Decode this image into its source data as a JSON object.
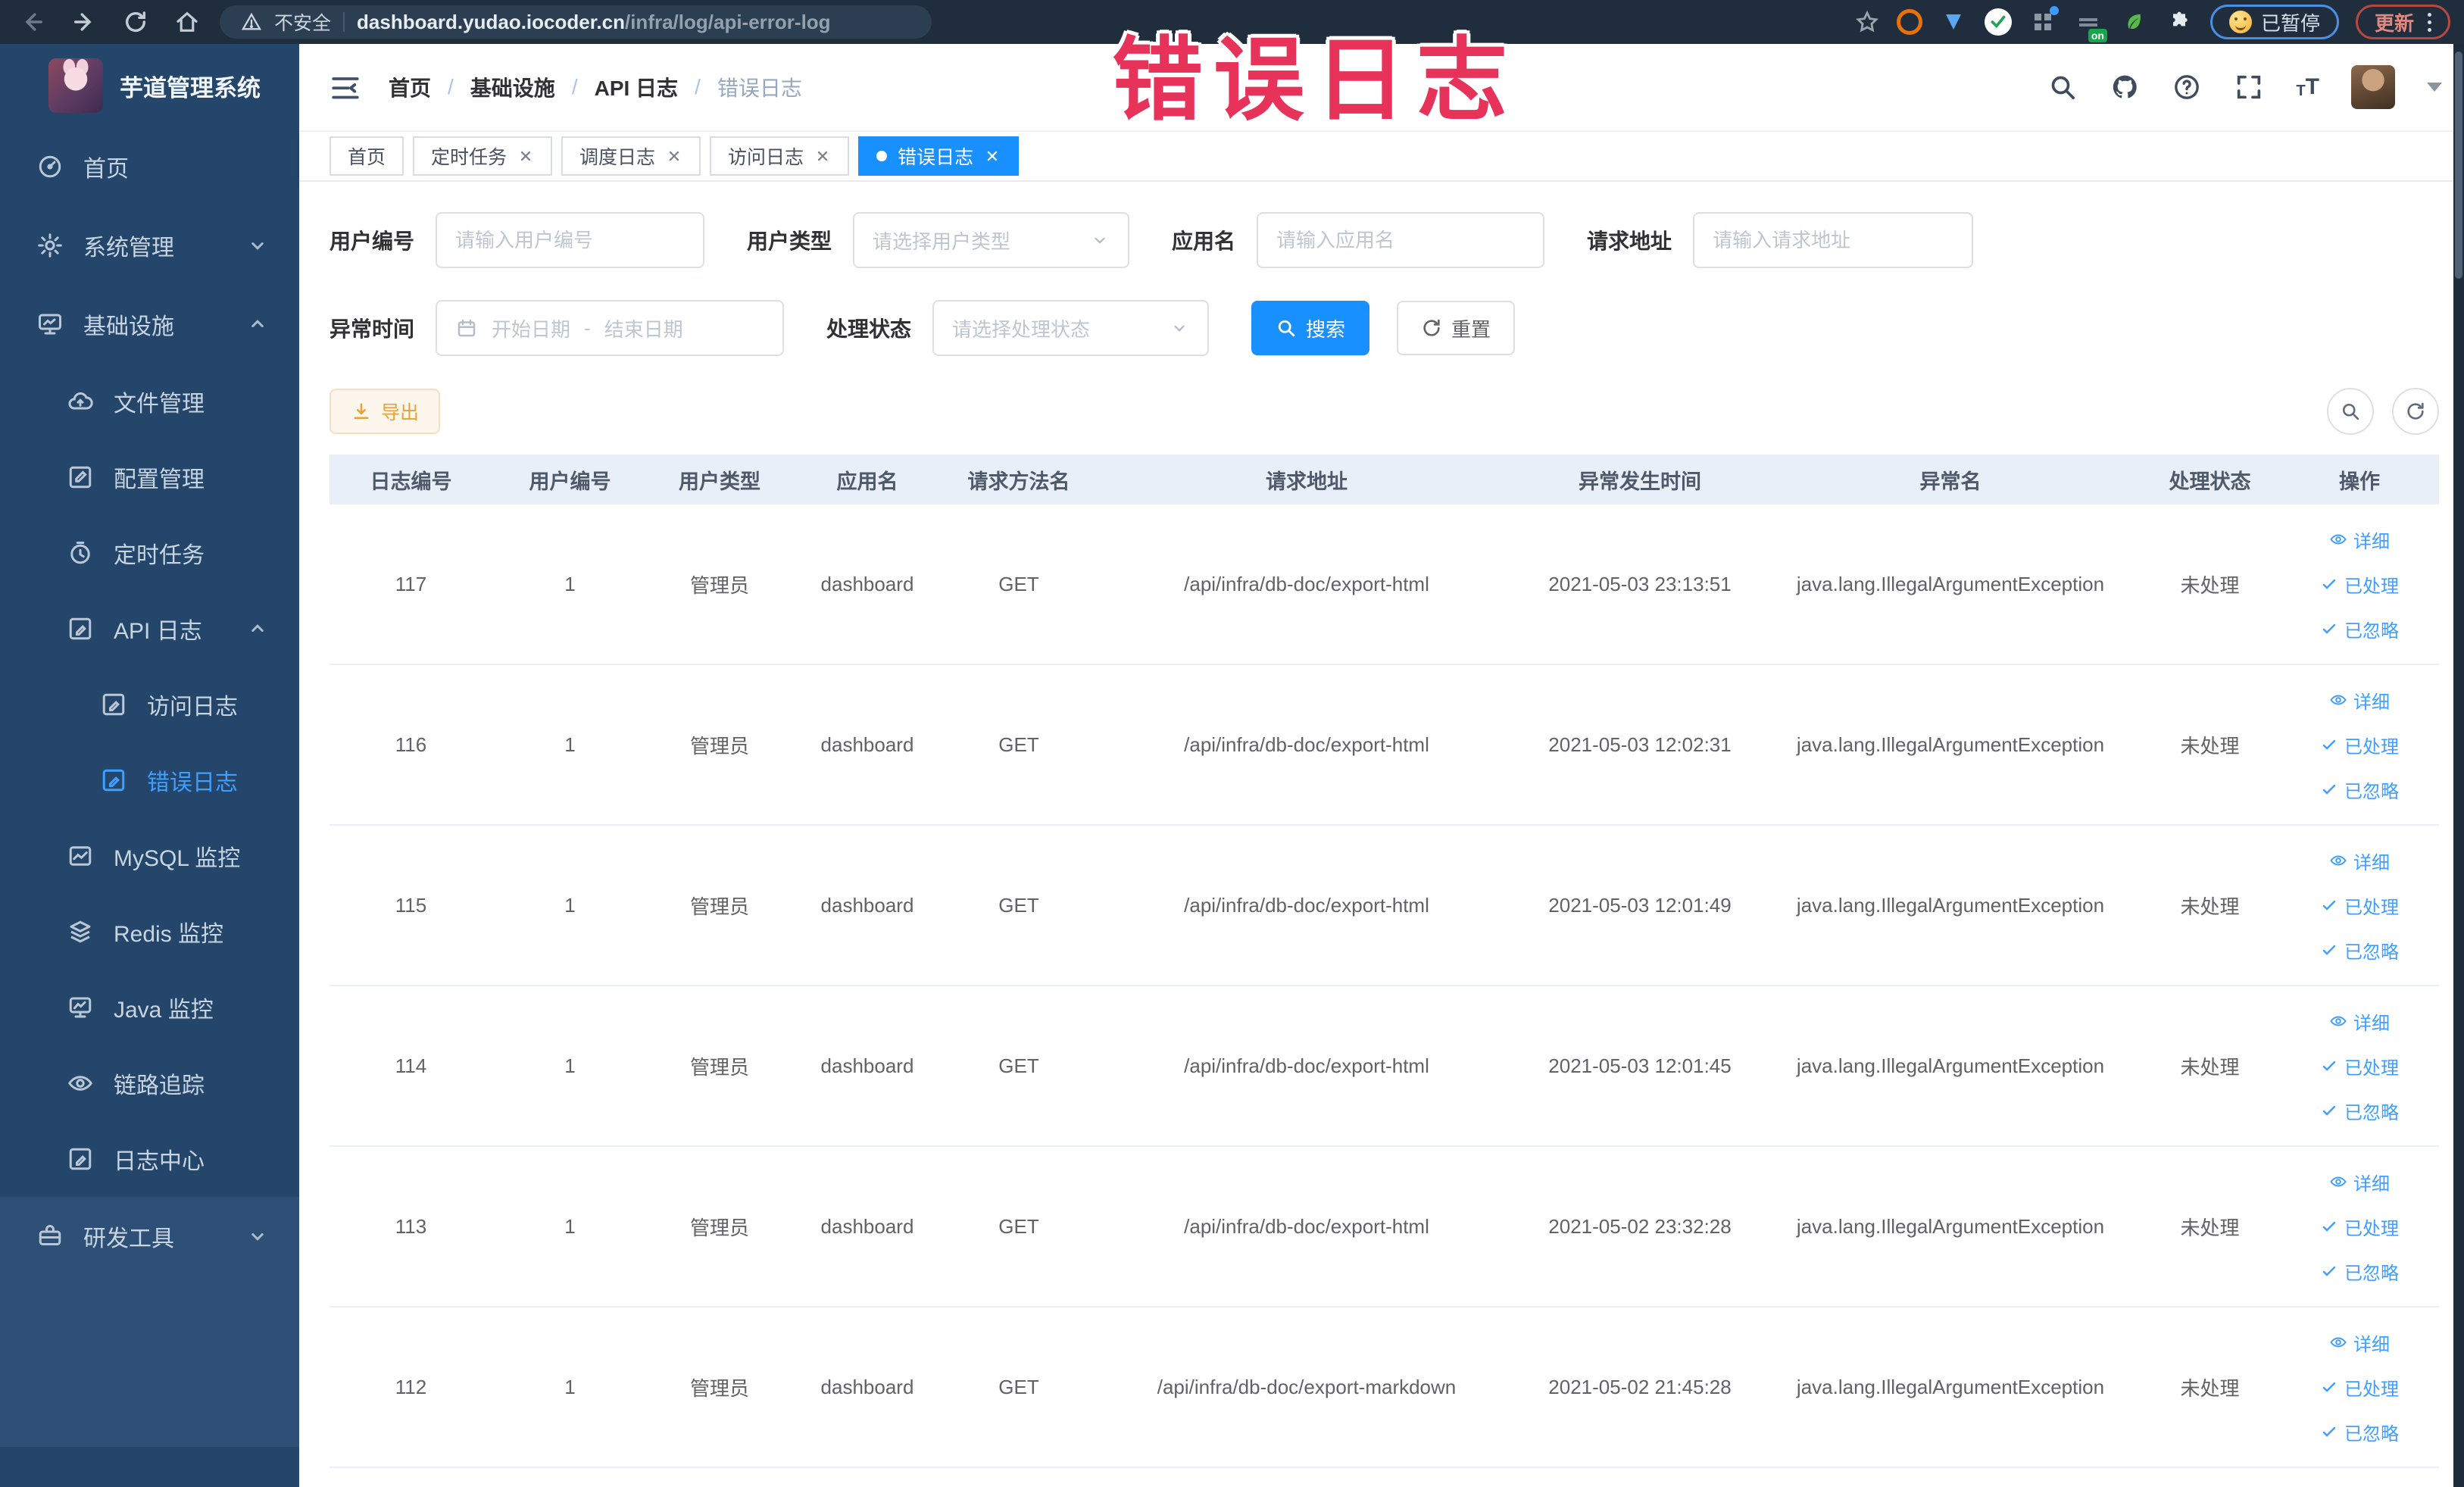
{
  "annotation": {
    "text": "错误日志",
    "color": "#e7325a"
  },
  "browser": {
    "security_label": "不安全",
    "url_host": "dashboard.yudao.iocoder.cn",
    "url_path": "/infra/log/api-error-log",
    "extension_badge": "on",
    "paused_label": "已暂停",
    "update_label": "更新"
  },
  "sidebar": {
    "app_title": "芋道管理系统",
    "items": [
      {
        "label": "首页"
      },
      {
        "label": "系统管理"
      },
      {
        "label": "基础设施"
      },
      {
        "label": "文件管理"
      },
      {
        "label": "配置管理"
      },
      {
        "label": "定时任务"
      },
      {
        "label": "API 日志"
      },
      {
        "label": "访问日志"
      },
      {
        "label": "错误日志"
      },
      {
        "label": "MySQL 监控"
      },
      {
        "label": "Redis 监控"
      },
      {
        "label": "Java 监控"
      },
      {
        "label": "链路追踪"
      },
      {
        "label": "日志中心"
      },
      {
        "label": "研发工具"
      }
    ]
  },
  "header": {
    "breadcrumb": [
      "首页",
      "基础设施",
      "API 日志",
      "错误日志"
    ],
    "separator": "/"
  },
  "tabs": [
    {
      "label": "首页"
    },
    {
      "label": "定时任务"
    },
    {
      "label": "调度日志"
    },
    {
      "label": "访问日志"
    },
    {
      "label": "错误日志"
    }
  ],
  "filters": {
    "user_id_label": "用户编号",
    "user_id_placeholder": "请输入用户编号",
    "user_type_label": "用户类型",
    "user_type_placeholder": "请选择用户类型",
    "app_name_label": "应用名",
    "app_name_placeholder": "请输入应用名",
    "request_url_label": "请求地址",
    "request_url_placeholder": "请输入请求地址",
    "error_time_label": "异常时间",
    "date_start_placeholder": "开始日期",
    "date_separator": "-",
    "date_end_placeholder": "结束日期",
    "process_status_label": "处理状态",
    "process_status_placeholder": "请选择处理状态",
    "search_label": "搜索",
    "reset_label": "重置"
  },
  "toolbar": {
    "export_label": "导出"
  },
  "table": {
    "columns": [
      "日志编号",
      "用户编号",
      "用户类型",
      "应用名",
      "请求方法名",
      "请求地址",
      "异常发生时间",
      "异常名",
      "处理状态",
      "操作"
    ],
    "actions": [
      "详细",
      "已处理",
      "已忽略"
    ],
    "rows": [
      {
        "id": "117",
        "user_id": "1",
        "user_type": "管理员",
        "app": "dashboard",
        "method": "GET",
        "url": "/api/infra/db-doc/export-html",
        "time": "2021-05-03 23:13:51",
        "exception": "java.lang.IllegalArgumentException",
        "status": "未处理"
      },
      {
        "id": "116",
        "user_id": "1",
        "user_type": "管理员",
        "app": "dashboard",
        "method": "GET",
        "url": "/api/infra/db-doc/export-html",
        "time": "2021-05-03 12:02:31",
        "exception": "java.lang.IllegalArgumentException",
        "status": "未处理"
      },
      {
        "id": "115",
        "user_id": "1",
        "user_type": "管理员",
        "app": "dashboard",
        "method": "GET",
        "url": "/api/infra/db-doc/export-html",
        "time": "2021-05-03 12:01:49",
        "exception": "java.lang.IllegalArgumentException",
        "status": "未处理"
      },
      {
        "id": "114",
        "user_id": "1",
        "user_type": "管理员",
        "app": "dashboard",
        "method": "GET",
        "url": "/api/infra/db-doc/export-html",
        "time": "2021-05-03 12:01:45",
        "exception": "java.lang.IllegalArgumentException",
        "status": "未处理"
      },
      {
        "id": "113",
        "user_id": "1",
        "user_type": "管理员",
        "app": "dashboard",
        "method": "GET",
        "url": "/api/infra/db-doc/export-html",
        "time": "2021-05-02 23:32:28",
        "exception": "java.lang.IllegalArgumentException",
        "status": "未处理"
      },
      {
        "id": "112",
        "user_id": "1",
        "user_type": "管理员",
        "app": "dashboard",
        "method": "GET",
        "url": "/api/infra/db-doc/export-markdown",
        "time": "2021-05-02 21:45:28",
        "exception": "java.lang.IllegalArgumentException",
        "status": "未处理"
      }
    ]
  }
}
